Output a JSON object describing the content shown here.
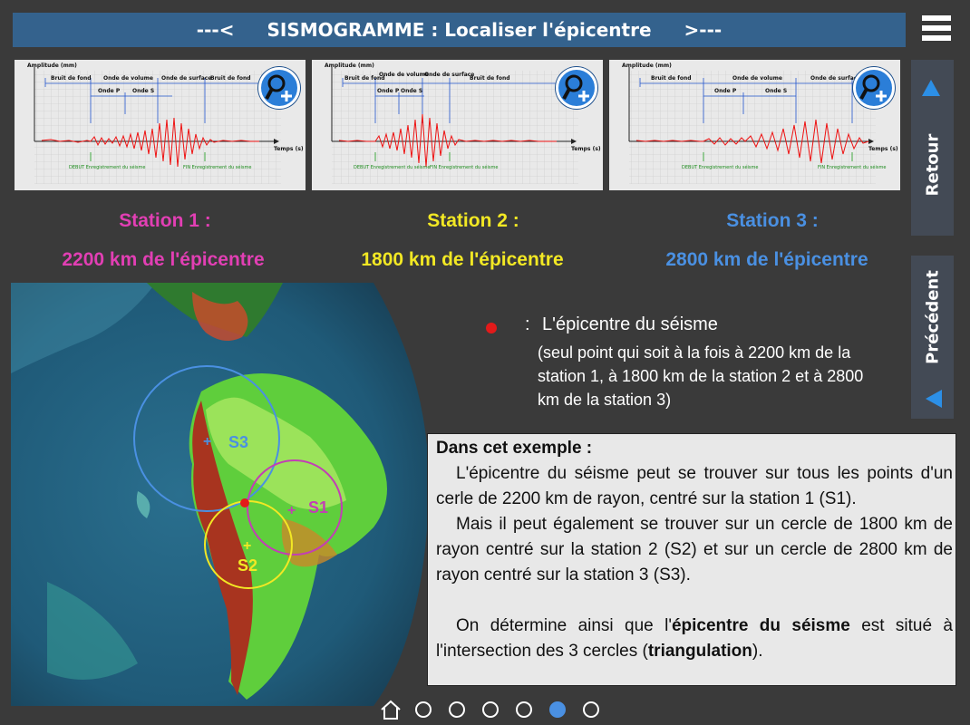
{
  "header": {
    "left_arrow": "---<",
    "title": "SISMOGRAMME : Localiser l'épicentre",
    "right_arrow": ">---"
  },
  "sidebar": {
    "retour_label": "Retour",
    "precedent_label": "Précédent"
  },
  "seismograms": [
    {
      "amplitude_label": "Amplitude (mm)",
      "time_label": "Temps (s)",
      "bruit_fond_1": "Bruit de fond",
      "onde_volume": "Onde de volume",
      "onde_surface": "Onde de surface",
      "bruit_fond_2": "Bruit de fond",
      "onde_p": "Onde P",
      "onde_s": "Onde S",
      "debut": "DEBUT Enregistrement du séisme",
      "fin": "FIN Enregistrement du séisme"
    },
    {
      "amplitude_label": "Amplitude (mm)",
      "time_label": "Temps (s)",
      "bruit_fond_1": "Bruit de fond",
      "onde_volume": "Onde de volume",
      "onde_surface": "Onde de surface",
      "bruit_fond_2": "Bruit de fond",
      "onde_p": "Onde P",
      "onde_s": "Onde S",
      "debut": "DEBUT Enregistrement du séisme",
      "fin": "FIN Enregistrement du séisme"
    },
    {
      "amplitude_label": "Amplitude (mm)",
      "time_label": "Temps (s)",
      "bruit_fond_1": "Bruit de fond",
      "onde_volume": "Onde de volume",
      "onde_surface": "Onde de surface",
      "onde_p": "Onde P",
      "onde_s": "Onde S",
      "debut": "DEBUT Enregistrement du séisme",
      "fin": "FIN Enregistrement du séisme"
    }
  ],
  "stations": [
    {
      "name": "Station 1 :",
      "distance": "2200 km  de l'épicentre",
      "color": "#e23fb4"
    },
    {
      "name": "Station 2 :",
      "distance": "1800 km de l'épicentre",
      "color": "#f2e824"
    },
    {
      "name": "Station 3 :",
      "distance": "2800 km de l'épicentre",
      "color": "#4a90e2"
    }
  ],
  "map": {
    "labels": {
      "s1": "S1",
      "s2": "S2",
      "s3": "S3"
    }
  },
  "legend": {
    "colon": ":",
    "title": "L'épicentre du séisme",
    "description": "(seul point qui soit à la fois à 2200 km de la station 1, à 1800 km de la station 2 et à 2800 km de la station 3)"
  },
  "info": {
    "heading": "Dans cet exemple :",
    "p1": "L'épicentre du séisme peut se trouver sur tous les points d'un cerle de 2200 km de rayon, centré sur la station 1 (S1).",
    "p2": "Mais il peut également se trouver sur un cercle de 1800 km de rayon centré sur la station 2 (S2) et sur un cercle de 2800 km de rayon centré sur la station 3 (S3).",
    "p3_a": "On détermine ainsi que l'",
    "p3_b": "épicentre du séisme",
    "p3_c": " est situé à l'intersection des 3 cercles (",
    "p3_d": "triangulation",
    "p3_e": ")."
  },
  "pager": {
    "total": 6,
    "active_index": 4
  },
  "colors": {
    "header": "#34628d",
    "background": "#3a3a3a",
    "sidebar": "#434a55",
    "active_dot": "#4a90e2",
    "epicenter": "#e21a1a"
  }
}
